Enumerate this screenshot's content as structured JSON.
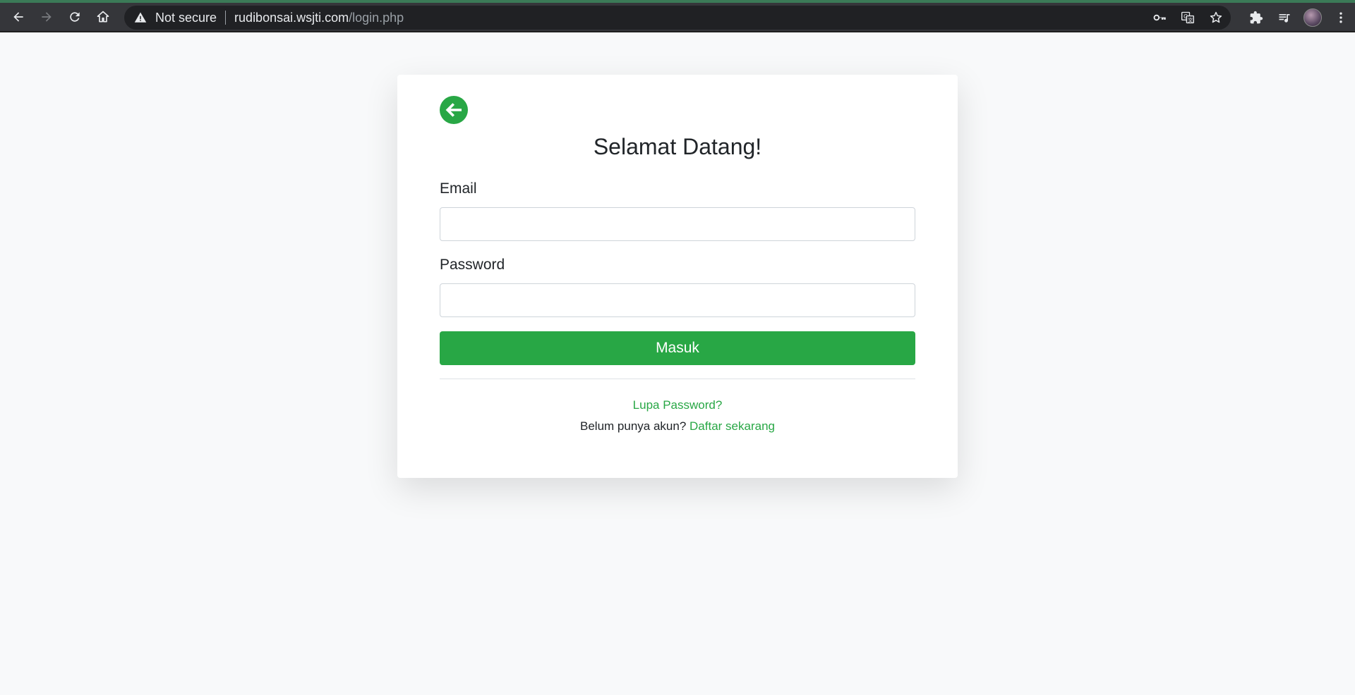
{
  "browser": {
    "security_label": "Not secure",
    "url_host": "rudibonsai.wsjti.com",
    "url_path": "/login.php",
    "icons": [
      "back-arrow-icon",
      "forward-arrow-icon",
      "reload-icon",
      "home-icon",
      "warning-icon",
      "key-icon",
      "translate-icon",
      "star-icon",
      "puzzle-icon",
      "media-queue-icon",
      "avatar",
      "kebab-menu-icon"
    ],
    "colors": {
      "frame_accent": "#3b7a57",
      "toolbar": "#35363a",
      "omnibox": "#202124"
    }
  },
  "login": {
    "title": "Selamat Datang!",
    "email_label": "Email",
    "email_value": "",
    "password_label": "Password",
    "password_value": "",
    "submit_label": "Masuk",
    "forgot_label": "Lupa Password?",
    "register_prompt": "Belum punya akun?",
    "register_link": "Daftar sekarang",
    "back_icon": "arrow-circle-left-icon",
    "colors": {
      "accent": "#28a745",
      "background": "#f8f9fa",
      "card": "#ffffff"
    }
  }
}
